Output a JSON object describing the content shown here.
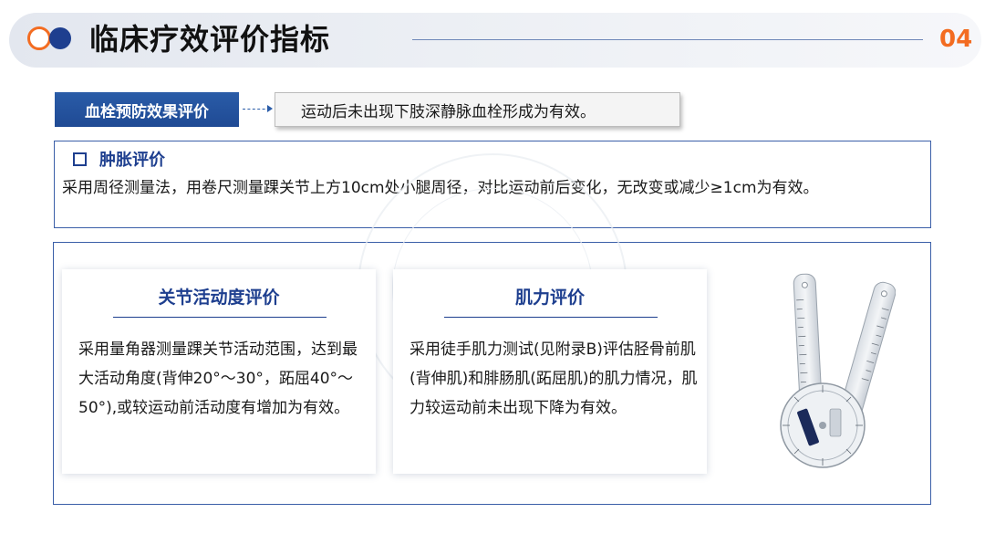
{
  "header": {
    "title": "临床疗效评价指标",
    "page_number": "04"
  },
  "thrombus": {
    "label": "血栓预防效果评价",
    "statement": "运动后未出现下肢深静脉血栓形成为有效。"
  },
  "swelling": {
    "title": "肿胀评价",
    "body": "采用周径测量法，用卷尺测量踝关节上方10cm处小腿周径，对比运动前后变化，无改变或减少≥1cm为有效。"
  },
  "cards": [
    {
      "title": "关节活动度评价",
      "body": "采用量角器测量踝关节活动范围，达到最大活动角度(背伸20°～30°，跖屈40°～50°),或较运动前活动度有增加为有效。"
    },
    {
      "title": "肌力评价",
      "body": "采用徒手肌力测试(见附录B)评估胫骨前肌(背伸肌)和腓肠肌(跖屈肌)的肌力情况，肌力较运动前未出现下降为有效。"
    }
  ],
  "colors": {
    "accent_blue": "#1e3f8f",
    "accent_orange": "#f36c21"
  },
  "images": {
    "goniometer": "goniometer-image"
  }
}
